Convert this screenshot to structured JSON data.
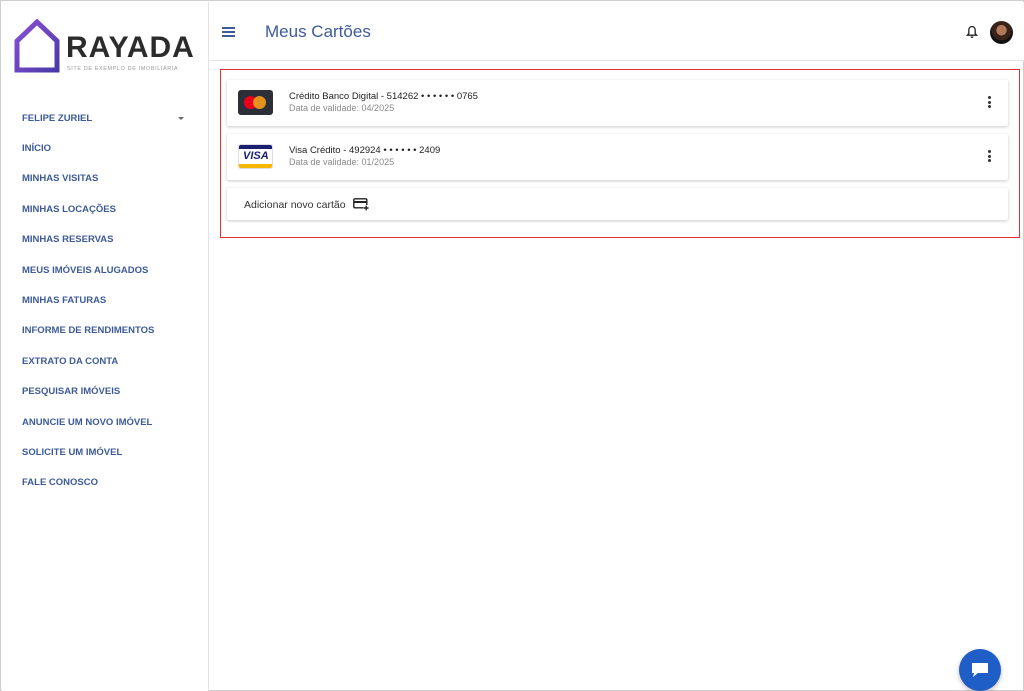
{
  "brand": {
    "name": "RAYADA",
    "tagline": "SITE DE EXEMPLO DE IMOBILIÁRIA",
    "accent_color": "#6a4cc7"
  },
  "header": {
    "title": "Meus Cartões",
    "menu_icon": "hamburger-icon",
    "notification_icon": "bell-icon"
  },
  "sidebar": {
    "user": "FELIPE ZURIEL",
    "items": [
      {
        "label": "INÍCIO"
      },
      {
        "label": "MINHAS VISITAS"
      },
      {
        "label": "MINHAS LOCAÇÕES"
      },
      {
        "label": "MINHAS RESERVAS"
      },
      {
        "label": "MEUS IMÓVEIS ALUGADOS"
      },
      {
        "label": "MINHAS FATURAS"
      },
      {
        "label": "INFORME DE RENDIMENTOS"
      },
      {
        "label": "EXTRATO DA CONTA"
      },
      {
        "label": "PESQUISAR IMÓVEIS"
      },
      {
        "label": "ANUNCIE UM NOVO IMÓVEL"
      },
      {
        "label": "SOLICITE UM IMÓVEL"
      },
      {
        "label": "FALE CONOSCO"
      }
    ]
  },
  "cards": [
    {
      "brand_icon": "mastercard-icon",
      "title": "Crédito Banco Digital - 514262 • • • • • • 0765",
      "expiry": "Data de validade: 04/2025"
    },
    {
      "brand_icon": "visa-icon",
      "brand_text": "VISA",
      "title": "Visa Crédito - 492924 • • • • • • 2409",
      "expiry": "Data de validade: 01/2025"
    }
  ],
  "add_card": {
    "label": "Adicionar novo cartão",
    "icon": "add-card-icon"
  },
  "colors": {
    "primary": "#3d5a99",
    "highlight_border": "#e03030",
    "chat_button": "#1f5ec7"
  }
}
